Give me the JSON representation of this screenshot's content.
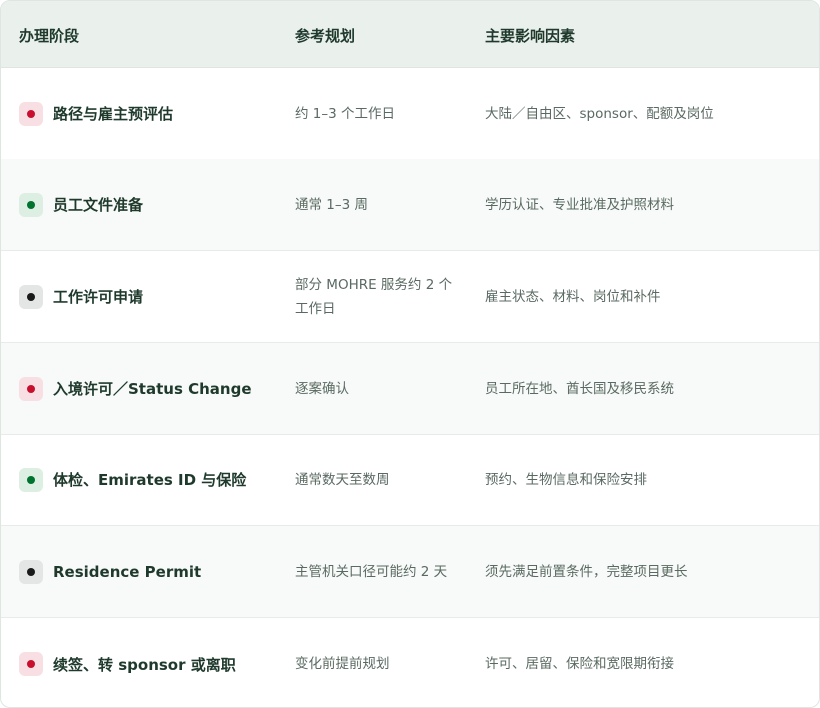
{
  "table": {
    "headers": {
      "stage": "办理阶段",
      "plan": "参考规划",
      "factors": "主要影响因素"
    },
    "rows": [
      {
        "stage": "路径与雇主预评估",
        "badge": "red",
        "plan": "约 1–3 个工作日",
        "factors": "大陆／自由区、sponsor、配额及岗位"
      },
      {
        "stage": "员工文件准备",
        "badge": "green",
        "plan": "通常 1–3 周",
        "factors": "学历认证、专业批准及护照材料"
      },
      {
        "stage": "工作许可申请",
        "badge": "black",
        "plan": "部分 MOHRE 服务约 2 个工作日",
        "factors": "雇主状态、材料、岗位和补件"
      },
      {
        "stage": "入境许可／Status Change",
        "badge": "red",
        "plan": "逐案确认",
        "factors": "员工所在地、酋长国及移民系统"
      },
      {
        "stage": "体检、Emirates ID 与保险",
        "badge": "green",
        "plan": "通常数天至数周",
        "factors": "预约、生物信息和保险安排"
      },
      {
        "stage": "Residence Permit",
        "badge": "black",
        "plan": "主管机关口径可能约 2 天",
        "factors": "须先满足前置条件，完整项目更长"
      },
      {
        "stage": "续签、转 sponsor 或离职",
        "badge": "red",
        "plan": "变化前提前规划",
        "factors": "许可、居留、保险和宽限期衔接"
      }
    ]
  },
  "colors": {
    "red": "#c8102e",
    "green": "#00732f",
    "black": "#1a1a1a",
    "header_bg": "#eaf0ec",
    "heading_text": "#1f3a2d",
    "body_text": "#5a6a62"
  },
  "icons": {
    "badge": "status-dot-icon"
  }
}
